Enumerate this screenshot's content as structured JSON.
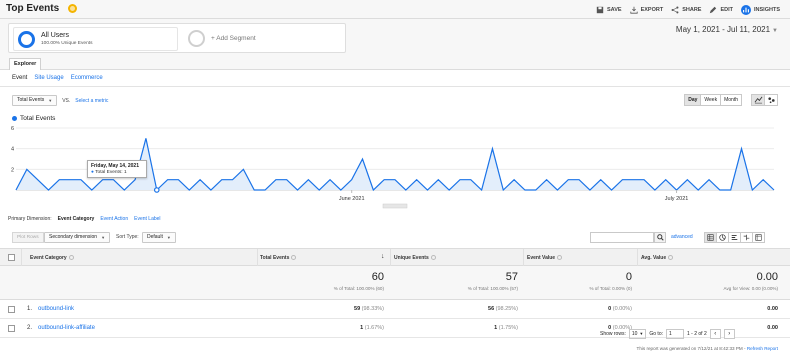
{
  "header": {
    "title": "Top Events",
    "actions": [
      {
        "label": "SAVE",
        "icon": "save-icon"
      },
      {
        "label": "EXPORT",
        "icon": "export-icon"
      },
      {
        "label": "SHARE",
        "icon": "share-icon"
      },
      {
        "label": "EDIT",
        "icon": "edit-icon"
      },
      {
        "label": "INSIGHTS",
        "icon": "insights-icon"
      }
    ]
  },
  "segments": {
    "active_name": "All Users",
    "active_sub": "100.00% Unique Events",
    "add_label": "+ Add Segment"
  },
  "date_range": "May 1, 2021 - Jul 11, 2021",
  "explorer_tab": "Explorer",
  "subtabs": [
    "Event",
    "Site Usage",
    "Ecommerce"
  ],
  "controls": {
    "metric": "Total Events",
    "vs": "VS.",
    "select_metric": "Select a metric",
    "granularity": [
      "Day",
      "Week",
      "Month"
    ]
  },
  "legend": {
    "metric": "Total Events",
    "color": "#1a73e8"
  },
  "tooltip": {
    "date": "Friday, May 14, 2021",
    "value": "Total Events: 1"
  },
  "chart_data": {
    "type": "area",
    "series": [
      {
        "name": "Total Events",
        "color": "#1a73e8",
        "values": [
          0,
          2,
          1,
          0,
          1,
          1,
          1,
          0,
          1,
          1,
          0,
          1,
          5,
          0,
          1,
          1,
          0,
          1,
          0,
          1,
          1,
          2,
          0,
          0,
          1,
          1,
          0,
          1,
          0,
          1,
          0,
          1,
          3,
          0,
          1,
          1,
          0,
          1,
          0,
          1,
          0,
          1,
          1,
          0,
          4,
          0,
          1,
          0,
          0,
          1,
          0,
          1,
          1,
          0,
          1,
          0,
          1,
          1,
          1,
          0,
          1,
          0,
          1,
          0,
          1,
          0,
          0,
          4,
          0,
          1,
          0
        ]
      }
    ],
    "yticks": [
      "6",
      "4",
      "2"
    ],
    "ylim": [
      0,
      6
    ],
    "x_labels": [
      {
        "label": "June 2021",
        "index": 31
      },
      {
        "label": "July 2021",
        "index": 61
      }
    ]
  },
  "primary_dimension": {
    "label": "Primary Dimension:",
    "items": [
      "Event Category",
      "Event Action",
      "Event Label"
    ]
  },
  "table_toolbar": {
    "plot_rows": "Plot Rows",
    "secondary": "Secondary dimension",
    "sort_type_label": "Sort Type:",
    "sort_type": "Default",
    "advanced": "advanced"
  },
  "table": {
    "headers": [
      "Event Category",
      "Total Events",
      "Unique Events",
      "Event Value",
      "Avg. Value"
    ],
    "totals": {
      "total_events": "60",
      "total_events_sub": "% of Total: 100.00% (60)",
      "unique_events": "57",
      "unique_events_sub": "% of Total: 100.00% (57)",
      "event_value": "0",
      "event_value_sub": "% of Total: 0.00% (0)",
      "avg_value": "0.00",
      "avg_value_sub": "Avg for View: 0.00 (0.00%)"
    },
    "rows": [
      {
        "num": "1.",
        "name": "outbound-link",
        "total": "59",
        "total_pct": "(98.33%)",
        "unique": "56",
        "unique_pct": "(98.25%)",
        "value": "0",
        "value_pct": "(0.00%)",
        "avg": "0.00"
      },
      {
        "num": "2.",
        "name": "outbound-link-affiliate",
        "total": "1",
        "total_pct": "(1.67%)",
        "unique": "1",
        "unique_pct": "(1.75%)",
        "value": "0",
        "value_pct": "(0.00%)",
        "avg": "0.00"
      }
    ]
  },
  "pagination": {
    "show_rows_label": "Show rows:",
    "show_rows": "10",
    "goto_label": "Go to:",
    "goto": "1",
    "range": "1 - 2 of 2"
  },
  "footer": {
    "generated": "This report was generated on 7/12/21 at 8:42:33 PM -",
    "refresh": "Refresh Report"
  }
}
